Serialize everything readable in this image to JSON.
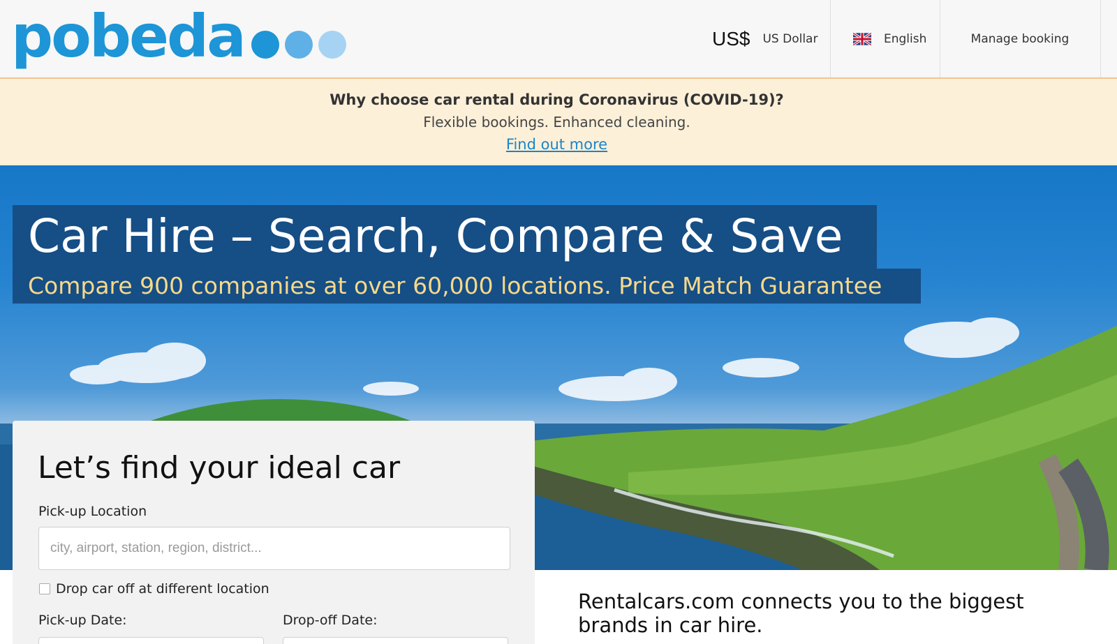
{
  "header": {
    "logo_text": "pobeda",
    "logo_dot_colors": [
      "#1d95d6",
      "#5fb0e6",
      "#a6d3f3"
    ],
    "currency_symbol": "US$",
    "currency_name": "US Dollar",
    "language": "English",
    "language_flag_icon": "uk-flag-icon",
    "manage_booking": "Manage booking"
  },
  "covid_banner": {
    "title": "Why choose car rental during Coronavirus (COVID-19)?",
    "subtitle": "Flexible bookings. Enhanced cleaning.",
    "link": "Find out more"
  },
  "hero": {
    "title": "Car Hire – Search, Compare & Save",
    "subtitle": "Compare 900 companies at over 60,000 locations. Price Match Guarantee"
  },
  "search_form": {
    "title": "Let’s find your ideal car",
    "pickup_location_label": "Pick-up Location",
    "pickup_location_placeholder": "city, airport, station, region, district...",
    "pickup_location_value": "",
    "drop_different_label": "Drop car off at different location",
    "drop_different_checked": false,
    "pickup_date_label": "Pick-up Date:",
    "dropoff_date_label": "Drop-off Date:"
  },
  "promo": {
    "text": "Rentalcars.com connects you to the biggest brands in car hire."
  },
  "colors": {
    "brand_blue": "#1d95d6",
    "banner_bg": "#fdf0d9",
    "hero_title_bg": "#164e86",
    "hero_subtitle": "#f7d98a",
    "link": "#1a85c8"
  }
}
